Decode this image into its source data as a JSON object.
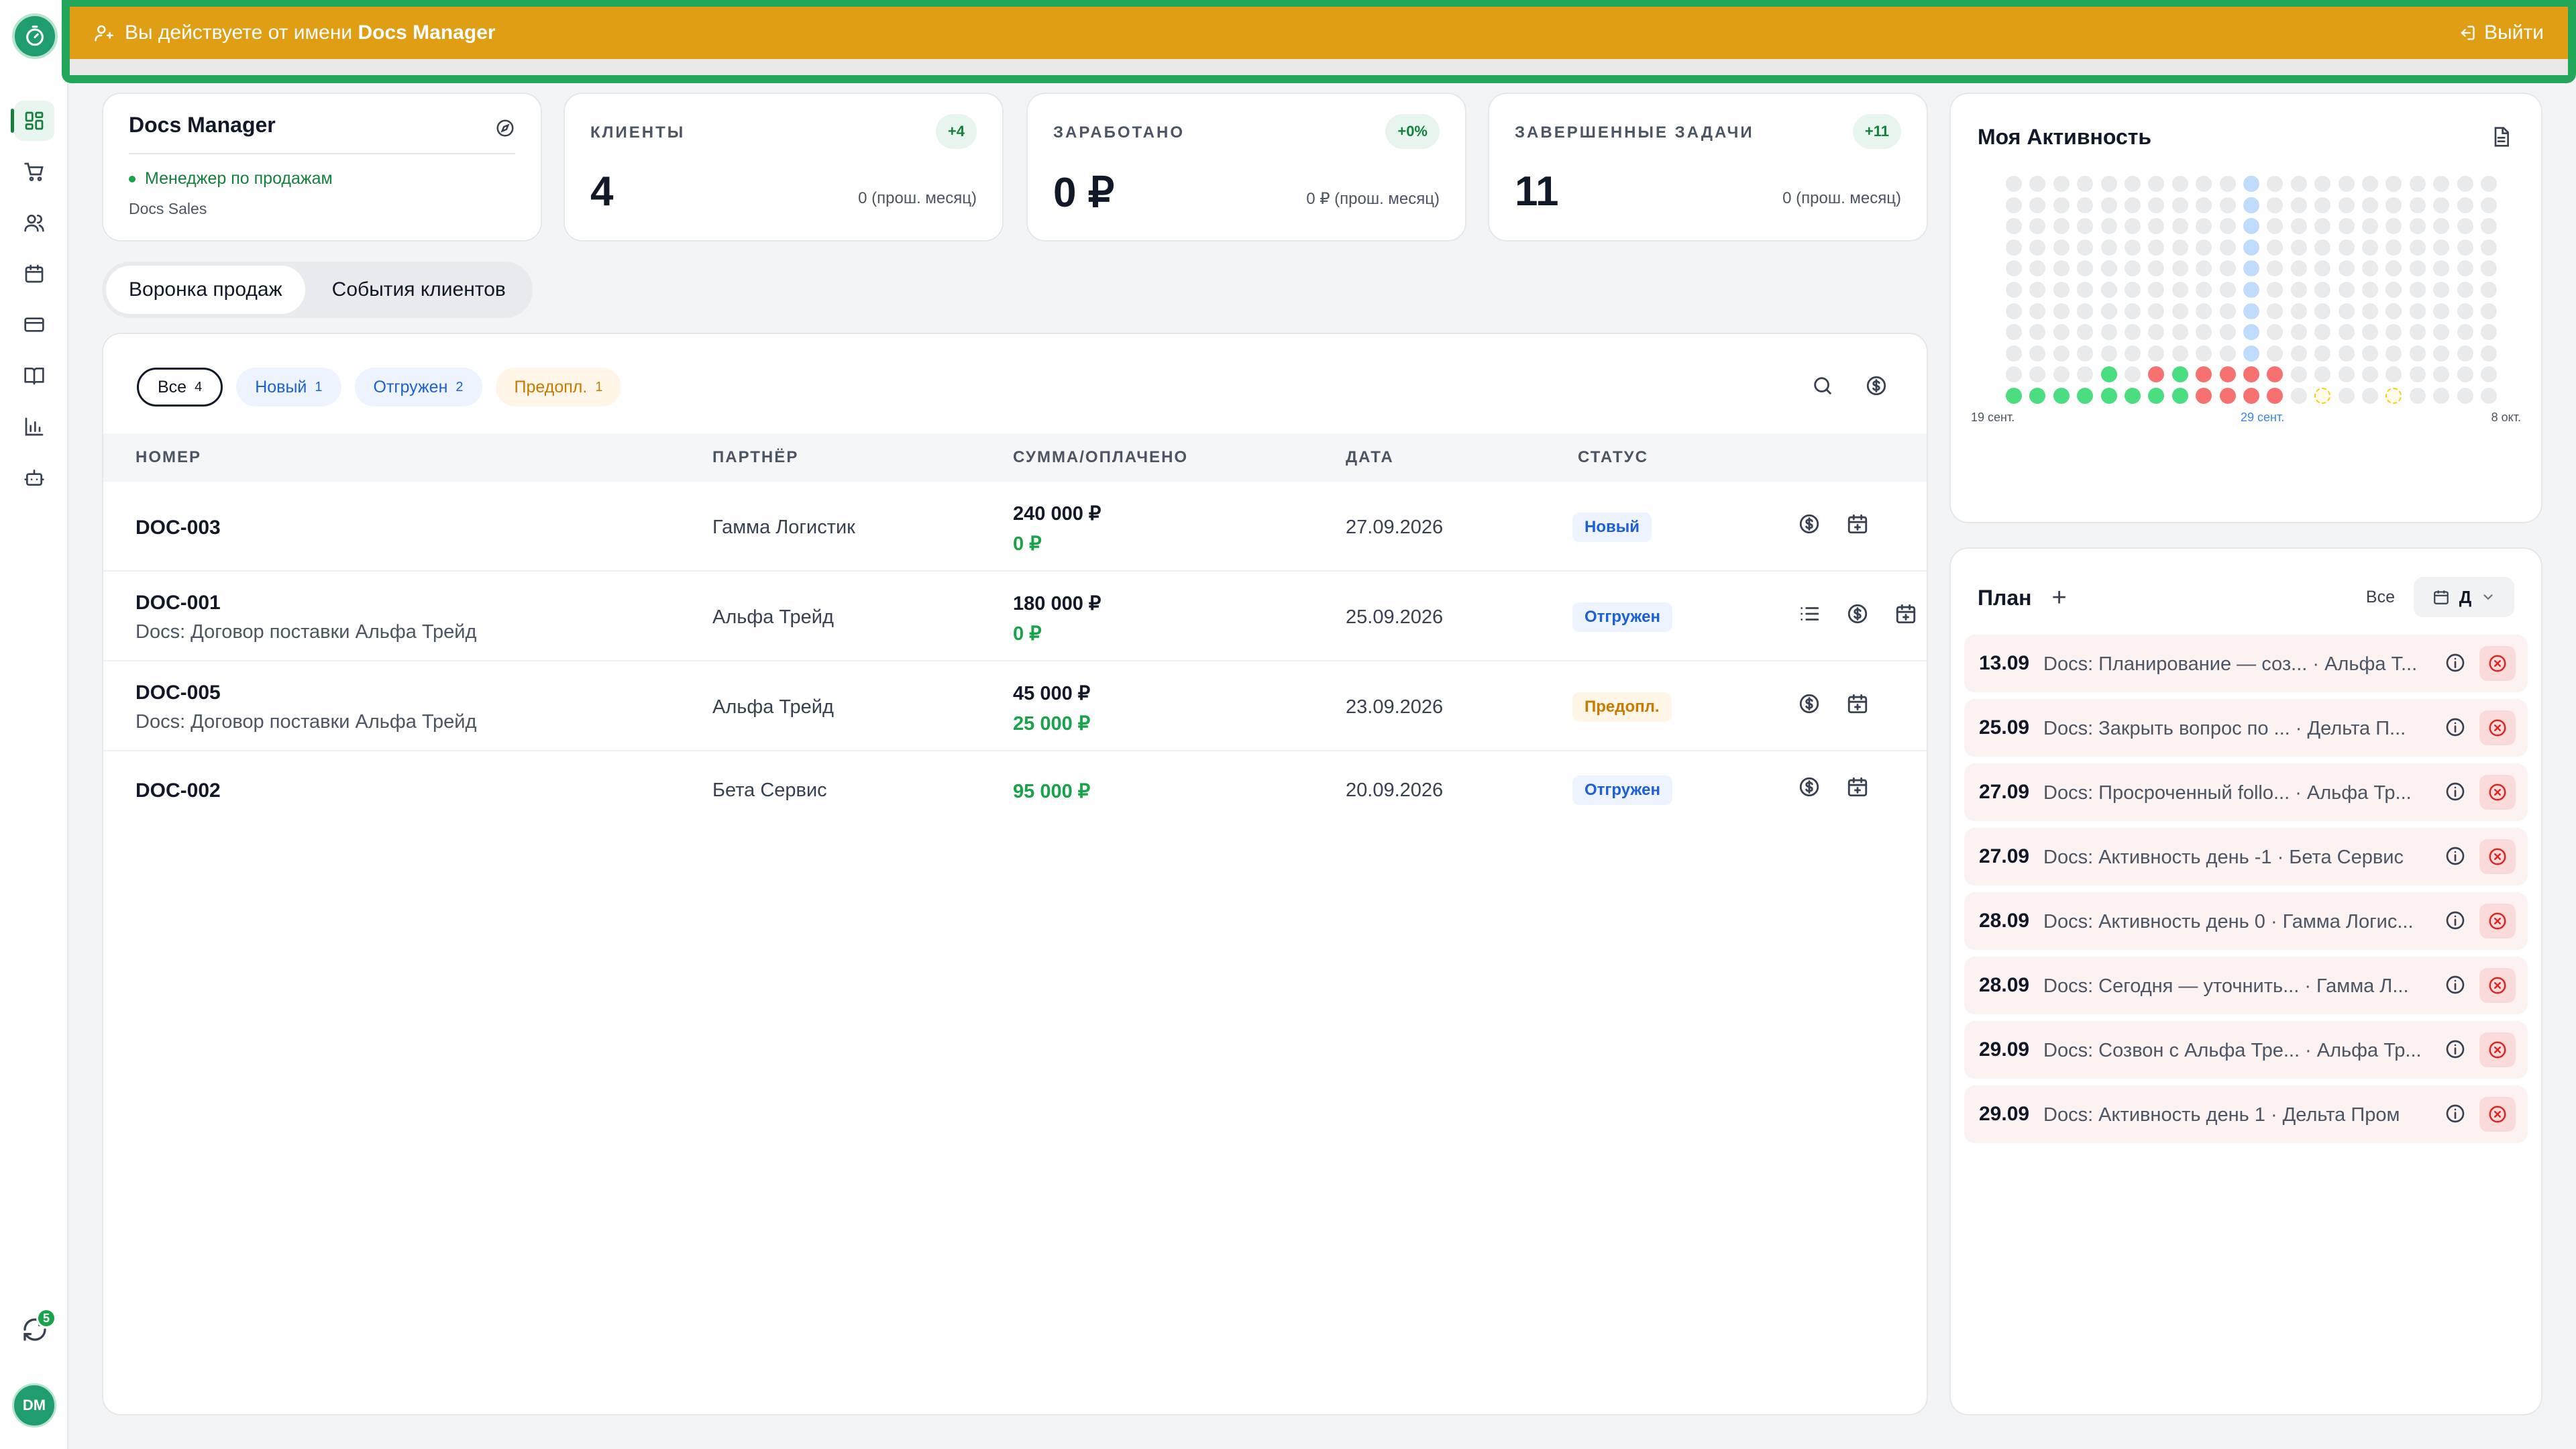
{
  "banner": {
    "prefix": "Вы действуете от имени",
    "user": "Docs Manager",
    "exit_label": "Выйти",
    "colors": {
      "frame": "#22a65a",
      "fill": "#e09e15"
    }
  },
  "sidebar": {
    "items": [
      {
        "icon": "dashboard-icon",
        "active": true
      },
      {
        "icon": "cart-icon",
        "active": false
      },
      {
        "icon": "users-icon",
        "active": false
      },
      {
        "icon": "calendar-icon",
        "active": false
      },
      {
        "icon": "credit-card-icon",
        "active": false
      },
      {
        "icon": "book-icon",
        "active": false
      },
      {
        "icon": "bar-chart-icon",
        "active": false
      },
      {
        "icon": "robot-icon",
        "active": false
      }
    ],
    "sync_badge": "5",
    "avatar_initials": "DM"
  },
  "profile": {
    "name": "Docs Manager",
    "role": "Менеджер по продажам",
    "team": "Docs Sales"
  },
  "stats": [
    {
      "label": "КЛИЕНТЫ",
      "badge": "+4",
      "value": "4",
      "prev": "0 (прош. месяц)"
    },
    {
      "label": "ЗАРАБОТАНО",
      "badge": "+0%",
      "value": "0 ₽",
      "prev": "0 ₽ (прош. месяц)"
    },
    {
      "label": "ЗАВЕРШЕННЫЕ ЗАДАЧИ",
      "badge": "+11",
      "value": "11",
      "prev": "0 (прош. месяц)"
    }
  ],
  "tabs": [
    {
      "label": "Воронка продаж",
      "active": true
    },
    {
      "label": "События клиентов",
      "active": false
    }
  ],
  "filters": [
    {
      "label": "Все",
      "count": "4",
      "active": true
    },
    {
      "label": "Новый",
      "count": "1"
    },
    {
      "label": "Отгружен",
      "count": "2"
    },
    {
      "label": "Предопл.",
      "count": "1"
    }
  ],
  "table": {
    "columns": [
      "НОМЕР",
      "ПАРТНЁР",
      "СУММА/ОПЛАЧЕНО",
      "ДАТА",
      "СТАТУС"
    ],
    "rows": [
      {
        "number": "DOC-003",
        "subtitle": "",
        "partner": "Гамма Логистик",
        "amount": "240 000 ₽",
        "paid": "0 ₽",
        "date": "27.09.2026",
        "status": "Новый"
      },
      {
        "number": "DOC-001",
        "subtitle": "Docs: Договор поставки Альфа Трейд",
        "partner": "Альфа Трейд",
        "amount": "180 000 ₽",
        "paid": "0 ₽",
        "date": "25.09.2026",
        "status": "Отгружен"
      },
      {
        "number": "DOC-005",
        "subtitle": "Docs: Договор поставки Альфа Трейд",
        "partner": "Альфа Трейд",
        "amount": "45 000 ₽",
        "paid": "25 000 ₽",
        "date": "23.09.2026",
        "status": "Предопл."
      },
      {
        "number": "DOC-002",
        "subtitle": "",
        "partner": "Бета Сервис",
        "amount": "",
        "paid": "95 000 ₽",
        "date": "20.09.2026",
        "status": "Отгружен"
      }
    ]
  },
  "activity": {
    "title": "Моя Активность",
    "date_labels": {
      "start": "19 сент.",
      "mid": "29 сент.",
      "end": "8 окт."
    },
    "colors": {
      "empty": "#e5e7eb",
      "done": "#4ade80",
      "overdue": "#f87171",
      "today": "#bfdbfe",
      "planned": "#facc15"
    },
    "days": 21,
    "highlight_day_index": 10,
    "bottom_row": [
      "done",
      "done",
      "done",
      "done",
      "done",
      "done",
      "done",
      "done",
      "overdue",
      "overdue",
      "overdue",
      "overdue",
      "empty",
      "planned",
      "empty",
      "empty",
      "planned",
      "empty",
      "empty",
      "empty",
      "empty"
    ],
    "second_row": [
      "empty",
      "empty",
      "empty",
      "empty",
      "done",
      "empty",
      "overdue",
      "done",
      "overdue",
      "overdue",
      "overdue",
      "overdue",
      "empty",
      "empty",
      "empty",
      "empty",
      "empty",
      "empty",
      "empty",
      "empty",
      "empty"
    ]
  },
  "plan": {
    "title": "План",
    "filter_label": "Все",
    "period_label": "Д",
    "items": [
      {
        "date": "13.09",
        "text": "Docs: Планирование — соз... · Альфа Т..."
      },
      {
        "date": "25.09",
        "text": "Docs: Закрыть вопрос по ... · Дельта П..."
      },
      {
        "date": "27.09",
        "text": "Docs: Просроченный follo... · Альфа Тр..."
      },
      {
        "date": "27.09",
        "text": "Docs: Активность день -1 · Бета Сервис"
      },
      {
        "date": "28.09",
        "text": "Docs: Активность день 0 · Гамма Логис..."
      },
      {
        "date": "28.09",
        "text": "Docs: Сегодня — уточнить... · Гамма Л..."
      },
      {
        "date": "29.09",
        "text": "Docs: Созвон с Альфа Тре... · Альфа Тр..."
      },
      {
        "date": "29.09",
        "text": "Docs: Активность день 1 · Дельта Пром"
      }
    ]
  }
}
